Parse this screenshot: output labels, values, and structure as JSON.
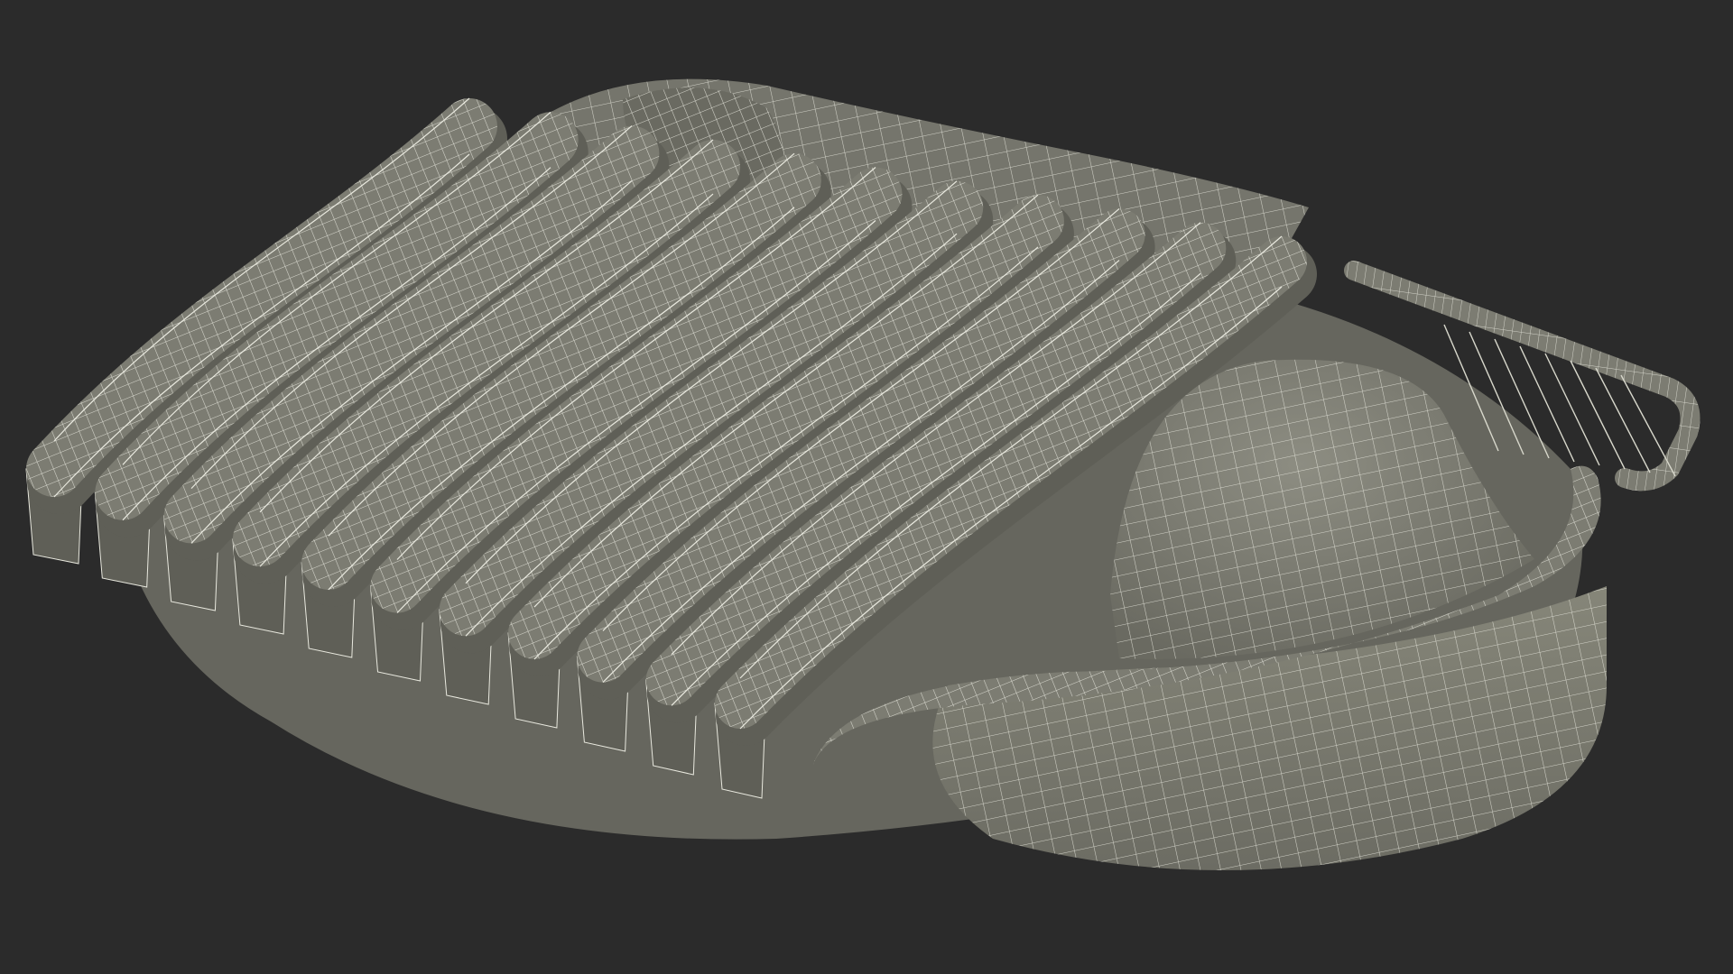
{
  "scene": {
    "background_color": "#2b2b2b",
    "model_fill_color": "#7c7c72",
    "model_shadow_color": "#5f5f57",
    "model_highlight_color": "#8a8a80",
    "wire_color": "#e9e9df",
    "slat_count": 11,
    "render_mode": "wireframe-on-shaded"
  }
}
